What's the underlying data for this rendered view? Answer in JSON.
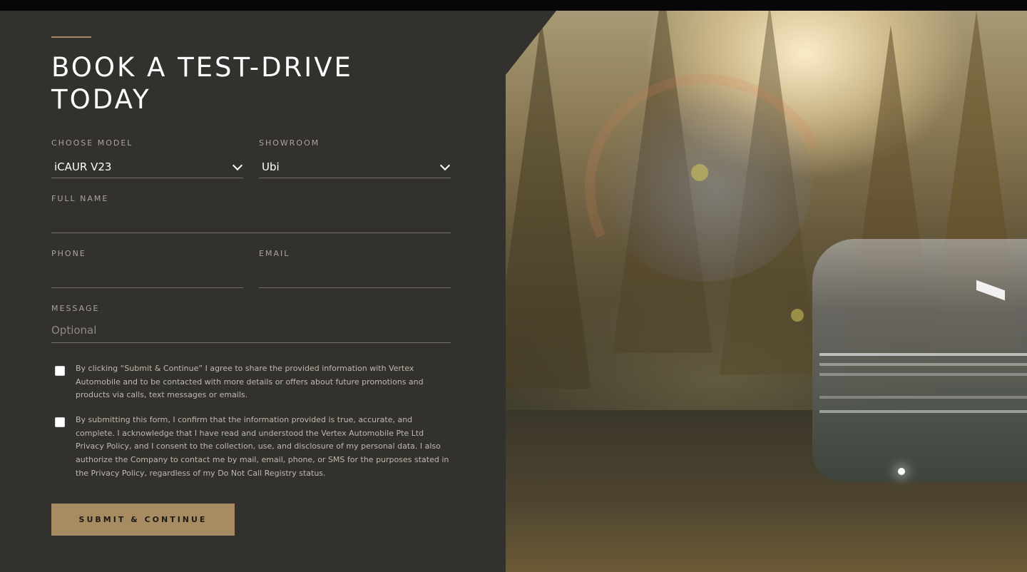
{
  "form": {
    "title_line1": "BOOK A TEST-DRIVE",
    "title_line2": "TODAY",
    "model_label": "CHOOSE MODEL",
    "model_value": "iCAUR V23",
    "showroom_label": "SHOWROOM",
    "showroom_value": "Ubi",
    "full_name_label": "FULL NAME",
    "full_name_value": "",
    "phone_label": "PHONE",
    "phone_value": "",
    "email_label": "EMAIL",
    "email_value": "",
    "message_label": "MESSAGE",
    "message_placeholder": "Optional",
    "consent_marketing": "By clicking “Submit & Continue” I agree to share the provided information with Vertex Automobile and to be contacted with more details or offers about future promotions and products via calls, text messages or emails.",
    "consent_privacy": "By submitting this form, I confirm that the information provided is true, accurate, and complete. I acknowledge that I have read and understood the Vertex Automobile Pte Ltd Privacy Policy, and I consent to the collection, use, and disclosure of my personal data. I also authorize the Company to contact me by mail, email, phone, or SMS for the purposes stated in the Privacy Policy, regardless of my Do Not Call Registry status.",
    "submit_label": "SUBMIT & CONTINUE"
  },
  "icons": {
    "model_dropdown": "chevron-down-icon",
    "showroom_dropdown": "chevron-down-icon"
  },
  "colors": {
    "panel_bg": "#33312d",
    "accent": "#a78b63",
    "text_primary": "#ffffff",
    "text_muted": "#a9a599"
  }
}
